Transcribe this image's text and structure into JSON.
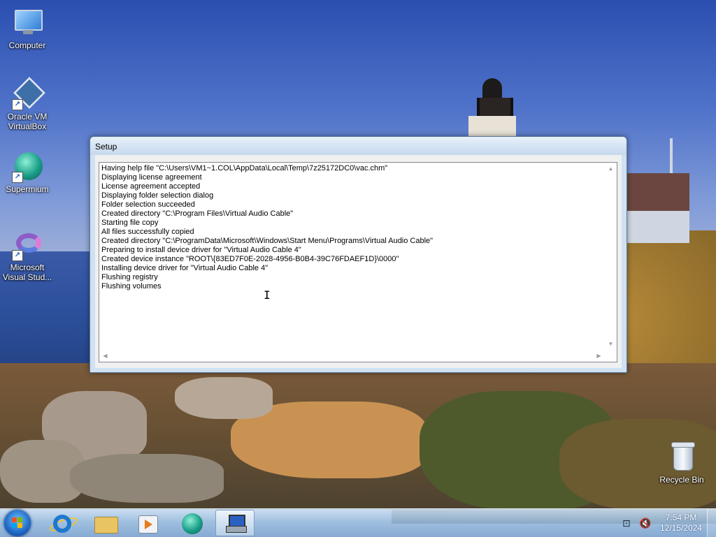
{
  "desktop": {
    "icons": [
      {
        "label": "Computer",
        "icon": "computer-icon"
      },
      {
        "label": "Oracle VM VirtualBox",
        "icon": "virtualbox-icon"
      },
      {
        "label": "Supermium",
        "icon": "supermium-icon"
      },
      {
        "label": "Microsoft Visual Stud...",
        "icon": "visual-studio-icon"
      },
      {
        "label": "Recycle Bin",
        "icon": "recycle-bin-icon"
      }
    ]
  },
  "window": {
    "title": "Setup",
    "log": [
      "Having help file \"C:\\Users\\VM1~1.COL\\AppData\\Local\\Temp\\7z25172DC0\\vac.chm\"",
      "Displaying license agreement",
      "License agreement accepted",
      "Displaying folder selection dialog",
      "Folder selection succeeded",
      "Created directory \"C:\\Program Files\\Virtual Audio Cable\"",
      "Starting file copy",
      "All files successfully copied",
      "Created directory \"C:\\ProgramData\\Microsoft\\Windows\\Start Menu\\Programs\\Virtual Audio Cable\"",
      "Preparing to install device driver for \"Virtual Audio Cable 4\"",
      "Created device instance \"ROOT\\{83ED7F0E-2028-4956-B0B4-39C76FDAEF1D}\\0000\"",
      "Installing device driver for \"Virtual Audio Cable 4\"",
      "Flushing registry",
      "Flushing volumes"
    ]
  },
  "taskbar": {
    "items": [
      "start-button",
      "internet-explorer-icon",
      "file-explorer-icon",
      "media-player-icon",
      "supermium-icon",
      "setup-icon"
    ],
    "active": "setup-icon",
    "clock": {
      "time": "7:54 PM",
      "date": "12/15/2024"
    },
    "tray": [
      "network-icon",
      "volume-muted-icon"
    ]
  },
  "colors": {
    "window_frame": "#cfe1f2",
    "taskbar": "#96b9dc",
    "accent": "#1f68c4"
  }
}
